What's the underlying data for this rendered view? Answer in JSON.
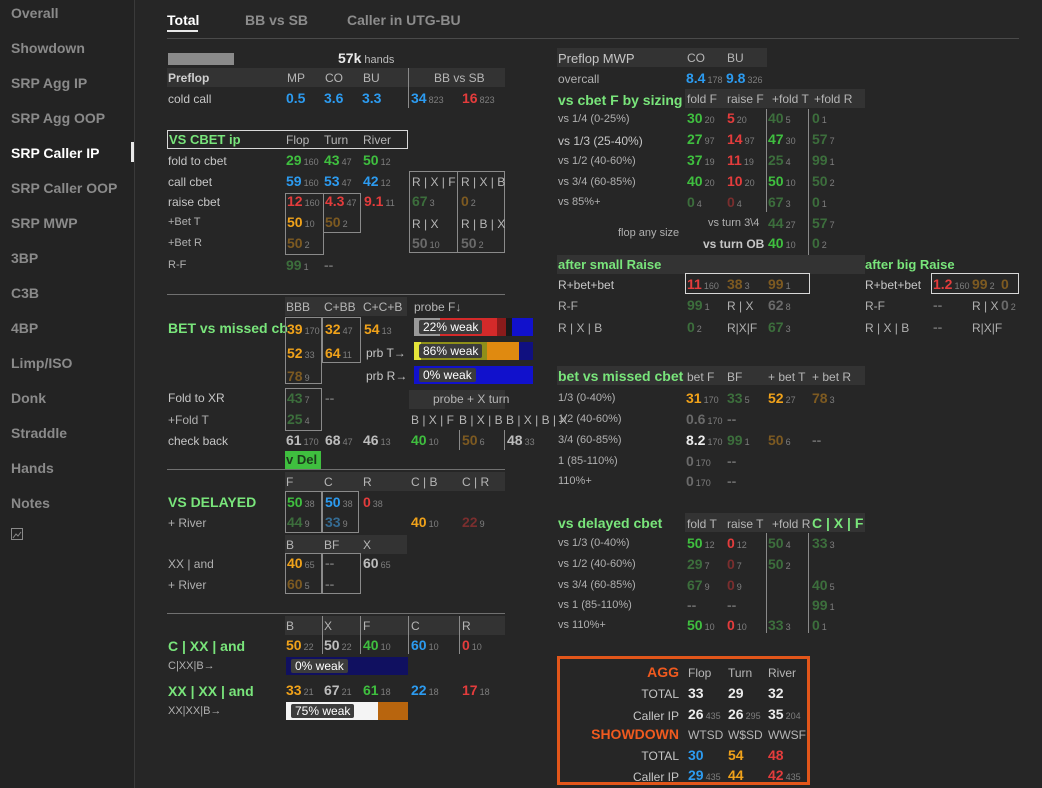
{
  "sidebar": {
    "items": [
      "Overall",
      "Showdown",
      "SRP Agg IP",
      "SRP Agg OOP",
      "SRP Caller IP",
      "SRP Caller OOP",
      "SRP MWP",
      "3BP",
      "C3B",
      "4BP",
      "Limp/ISO",
      "Donk",
      "Straddle",
      "Hands",
      "Notes"
    ],
    "active": "SRP Caller IP",
    "extra_icon": "image-icon"
  },
  "tabs": [
    "Total",
    "BB vs SB",
    "Caller in UTG-BU"
  ],
  "summary": {
    "hands_value": "57k",
    "hands_label": "hands"
  },
  "preflop": {
    "title": "Preflop",
    "headers": [
      "MP",
      "CO",
      "BU",
      "BB vs SB"
    ],
    "row_label": "cold call",
    "values": [
      {
        "v": "0.5",
        "c": "blue"
      },
      {
        "v": "3.6",
        "c": "blue"
      },
      {
        "v": "3.3",
        "c": "blue"
      },
      {
        "v": "34",
        "s": "823",
        "c": "blue"
      },
      {
        "v": "16",
        "s": "823",
        "c": "red"
      }
    ]
  },
  "vs_cbet_ip": {
    "title": "VS CBET ip",
    "headers": [
      "Flop",
      "Turn",
      "River"
    ],
    "rows": [
      {
        "label": "fold to cbet",
        "cells": [
          {
            "v": "29",
            "s": "160",
            "c": "green"
          },
          {
            "v": "43",
            "s": "47",
            "c": "green"
          },
          {
            "v": "50",
            "s": "12",
            "c": "green"
          }
        ]
      },
      {
        "label": "call cbet",
        "cells": [
          {
            "v": "59",
            "s": "160",
            "c": "blue"
          },
          {
            "v": "53",
            "s": "47",
            "c": "blue"
          },
          {
            "v": "42",
            "s": "12",
            "c": "blue"
          }
        ]
      },
      {
        "label": "raise cbet",
        "cells": [
          {
            "v": "12",
            "s": "160",
            "c": "red"
          },
          {
            "v": "4.3",
            "s": "47",
            "c": "red"
          },
          {
            "v": "9.1",
            "s": "11",
            "c": "red"
          }
        ]
      },
      {
        "label": "+Bet T",
        "cells": [
          {
            "v": "50",
            "s": "10",
            "c": "orange"
          },
          {
            "v": "50",
            "s": "2",
            "c": "mo"
          }
        ]
      },
      {
        "label": "+Bet R",
        "cells": [
          {
            "v": "50",
            "s": "2",
            "c": "mo"
          }
        ]
      },
      {
        "label": "R-F",
        "cells": [
          {
            "v": "99",
            "s": "1",
            "c": "mg"
          },
          {
            "v": "--",
            "c": "mgr"
          }
        ]
      }
    ],
    "side": {
      "h1": [
        "R | X | F",
        "R | X | B"
      ],
      "r1": [
        {
          "v": "67",
          "s": "3",
          "c": "mg"
        },
        {
          "v": "0",
          "s": "2",
          "c": "mo"
        }
      ],
      "h2": [
        "R | X",
        "R | B | X"
      ],
      "r2": [
        {
          "v": "50",
          "s": "10",
          "c": "mgr"
        },
        {
          "v": "50",
          "s": "2",
          "c": "mgr"
        }
      ]
    }
  },
  "bet_missed_cb": {
    "title": "BET vs missed cb",
    "headers": [
      "BBB",
      "C+BB",
      "C+C+B"
    ],
    "r1": [
      {
        "v": "39",
        "s": "170",
        "c": "orange"
      },
      {
        "v": "32",
        "s": "47",
        "c": "orange"
      },
      {
        "v": "54",
        "s": "13",
        "c": "orange"
      }
    ],
    "r2": [
      {
        "v": "52",
        "s": "33",
        "c": "orange"
      },
      {
        "v": "64",
        "s": "11",
        "c": "orange"
      }
    ],
    "r3": [
      {
        "v": "78",
        "s": "9",
        "c": "mo"
      }
    ],
    "probe_header": "probe F↓",
    "probe_bars": [
      {
        "label": "",
        "text": "22% weak",
        "segs": [
          {
            "w": 0.22,
            "c": "#9a9a9a"
          },
          {
            "w": 0.48,
            "c": "#d42a2a"
          },
          {
            "w": 0.07,
            "c": "#8a1b1b"
          },
          {
            "w": 0.05,
            "c": "#1a1a1a"
          },
          {
            "w": 0.18,
            "c": "#1111cc"
          }
        ]
      },
      {
        "label": "prb T→",
        "text": "86% weak",
        "segs": [
          {
            "w": 0.06,
            "c": "#e4e43a"
          },
          {
            "w": 0.55,
            "c": "#8f8f1a"
          },
          {
            "w": 0.27,
            "c": "#e08a10"
          },
          {
            "w": 0.12,
            "c": "#101080"
          }
        ]
      },
      {
        "label": "prb R→",
        "text": "0% weak",
        "segs": [
          {
            "w": 1.0,
            "c": "#1111cc"
          }
        ]
      }
    ],
    "fold_to_xr": {
      "label": "Fold to XR",
      "cells": [
        {
          "v": "43",
          "s": "7",
          "c": "mg"
        },
        {
          "v": "--",
          "c": "mgr"
        }
      ]
    },
    "fold_t": {
      "label": "+Fold T",
      "cells": [
        {
          "v": "25",
          "s": "4",
          "c": "mg"
        }
      ]
    },
    "probe_x_turn": {
      "title": "probe + X turn",
      "headers": [
        "B | X | F",
        "B | X | B",
        "B | X | B | X"
      ],
      "cells": [
        {
          "v": "40",
          "s": "10",
          "c": "green"
        },
        {
          "v": "50",
          "s": "6",
          "c": "mo"
        },
        {
          "v": "48",
          "s": "33",
          "c": "gray"
        }
      ]
    },
    "check_back": {
      "label": "check back",
      "cells": [
        {
          "v": "61",
          "s": "170",
          "c": "gray"
        },
        {
          "v": "68",
          "s": "47",
          "c": "gray"
        },
        {
          "v": "46",
          "s": "13",
          "c": "gray"
        }
      ]
    },
    "v_del_chip": "v Del"
  },
  "vs_delayed": {
    "title": "VS DELAYED",
    "headers": [
      "F",
      "C",
      "R",
      "C | B",
      "C | R"
    ],
    "r1": [
      {
        "v": "50",
        "s": "38",
        "c": "green"
      },
      {
        "v": "50",
        "s": "38",
        "c": "blue"
      },
      {
        "v": "0",
        "s": "38",
        "c": "red"
      }
    ],
    "river": {
      "label": "+ River",
      "cells": [
        {
          "v": "44",
          "s": "9",
          "c": "mg"
        },
        {
          "v": "33",
          "s": "9",
          "c": "mb"
        },
        {
          "v": "40",
          "s": "10",
          "c": "orange"
        },
        {
          "v": "22",
          "s": "9",
          "c": "mr"
        }
      ]
    },
    "headers2": [
      "B",
      "BF",
      "X"
    ],
    "xx_and": {
      "label": "XX | and",
      "cells": [
        {
          "v": "40",
          "s": "65",
          "c": "orange"
        },
        {
          "v": "--",
          "c": "mgr"
        },
        {
          "v": "60",
          "s": "65",
          "c": "gray"
        }
      ]
    },
    "river2": {
      "label": "+ River",
      "cells": [
        {
          "v": "60",
          "s": "5",
          "c": "mo"
        },
        {
          "v": "--",
          "c": "mgr"
        }
      ]
    }
  },
  "c_xx_and": {
    "title": "C | XX | and",
    "headers": [
      "B",
      "X",
      "F",
      "C",
      "R"
    ],
    "cells": [
      {
        "v": "50",
        "s": "22",
        "c": "orange"
      },
      {
        "v": "50",
        "s": "22",
        "c": "gray"
      },
      {
        "v": "40",
        "s": "10",
        "c": "green"
      },
      {
        "v": "60",
        "s": "10",
        "c": "blue"
      },
      {
        "v": "0",
        "s": "10",
        "c": "red"
      }
    ],
    "bar_label": "C|XX|B→",
    "bar": {
      "text": "0% weak",
      "segs": [
        {
          "w": 1.0,
          "c": "#101060"
        }
      ]
    }
  },
  "xx_xx_and": {
    "title": "XX | XX | and",
    "cells": [
      {
        "v": "33",
        "s": "21",
        "c": "orange"
      },
      {
        "v": "67",
        "s": "21",
        "c": "gray"
      },
      {
        "v": "61",
        "s": "18",
        "c": "green"
      },
      {
        "v": "22",
        "s": "18",
        "c": "blue"
      },
      {
        "v": "17",
        "s": "18",
        "c": "red"
      }
    ],
    "bar_label": "XX|XX|B→",
    "bar": {
      "text": "75% weak",
      "segs": [
        {
          "w": 0.75,
          "c": "#f4f4f4"
        },
        {
          "w": 0.25,
          "c": "#b8650e"
        }
      ]
    }
  },
  "preflop_mwp": {
    "title": "Preflop MWP",
    "headers": [
      "CO",
      "BU"
    ],
    "row_label": "overcall",
    "cells": [
      {
        "v": "8.4",
        "s": "178",
        "c": "blue"
      },
      {
        "v": "9.8",
        "s": "326",
        "c": "blue"
      }
    ]
  },
  "cbet_sizing": {
    "title": "vs cbet F by sizing",
    "headers": [
      "fold F",
      "raise F",
      "+fold T",
      "+fold R"
    ],
    "rows": [
      {
        "label": "vs 1/4 (0-25%)",
        "cells": [
          {
            "v": "30",
            "s": "20",
            "c": "green"
          },
          {
            "v": "5",
            "s": "20",
            "c": "red"
          },
          {
            "v": "40",
            "s": "5",
            "c": "mg"
          },
          {
            "v": "0",
            "s": "1",
            "c": "mg"
          }
        ]
      },
      {
        "label": "vs 1/3 (25-40%)",
        "cells": [
          {
            "v": "27",
            "s": "97",
            "c": "green"
          },
          {
            "v": "14",
            "s": "97",
            "c": "red"
          },
          {
            "v": "47",
            "s": "30",
            "c": "green"
          },
          {
            "v": "57",
            "s": "7",
            "c": "mg"
          }
        ]
      },
      {
        "label": "vs 1/2 (40-60%)",
        "cells": [
          {
            "v": "37",
            "s": "19",
            "c": "green"
          },
          {
            "v": "11",
            "s": "19",
            "c": "red"
          },
          {
            "v": "25",
            "s": "4",
            "c": "mg"
          },
          {
            "v": "99",
            "s": "1",
            "c": "mg"
          }
        ]
      },
      {
        "label": "vs 3/4 (60-85%)",
        "cells": [
          {
            "v": "40",
            "s": "20",
            "c": "green"
          },
          {
            "v": "10",
            "s": "20",
            "c": "red"
          },
          {
            "v": "50",
            "s": "10",
            "c": "green"
          },
          {
            "v": "50",
            "s": "2",
            "c": "mg"
          }
        ]
      },
      {
        "label": "vs 85%+",
        "cells": [
          {
            "v": "0",
            "s": "4",
            "c": "mg"
          },
          {
            "v": "0",
            "s": "4",
            "c": "mr"
          },
          {
            "v": "67",
            "s": "3",
            "c": "mg"
          },
          {
            "v": "0",
            "s": "1",
            "c": "mg"
          }
        ]
      }
    ],
    "flop_any": "flop any size",
    "turn34": {
      "label": "vs turn 3\\4",
      "cells": [
        {
          "v": "44",
          "s": "27",
          "c": "mg"
        },
        {
          "v": "57",
          "s": "7",
          "c": "mg"
        }
      ]
    },
    "turnob": {
      "label": "vs turn OB",
      "cells": [
        {
          "v": "40",
          "s": "10",
          "c": "green"
        },
        {
          "v": "0",
          "s": "2",
          "c": "mg"
        }
      ]
    }
  },
  "after_small_raise": {
    "title": "after small Raise",
    "r1": {
      "label": "R+bet+bet",
      "cells": [
        {
          "v": "11",
          "s": "160",
          "c": "red"
        },
        {
          "v": "38",
          "s": "3",
          "c": "mo"
        },
        {
          "v": "99",
          "s": "1",
          "c": "mo"
        }
      ]
    },
    "r2": {
      "label": "R-F",
      "cells": [
        {
          "v": "99",
          "s": "1",
          "c": "mg"
        }
      ],
      "label2": "R | X",
      "cells2": [
        {
          "v": "62",
          "s": "8",
          "c": "mgr"
        }
      ]
    },
    "r3": {
      "label": "R | X | B",
      "cells": [
        {
          "v": "0",
          "s": "2",
          "c": "mg"
        }
      ],
      "label2": "R|X|F",
      "cells2": [
        {
          "v": "67",
          "s": "3",
          "c": "mg"
        }
      ]
    }
  },
  "after_big_raise": {
    "title": "after big Raise",
    "r1": {
      "label": "R+bet+bet",
      "cells": [
        {
          "v": "1.2",
          "s": "160",
          "c": "red"
        },
        {
          "v": "99",
          "s": "2",
          "c": "mo"
        },
        {
          "v": "0",
          "c": "mo"
        }
      ]
    },
    "r2": {
      "label": "R-F",
      "cells": [
        {
          "v": "--",
          "c": "mgr"
        }
      ],
      "label2": "R | X",
      "cells2": [
        {
          "v": "0",
          "s": "2",
          "c": "mgr"
        }
      ]
    },
    "r3": {
      "label": "R | X | B",
      "cells": [
        {
          "v": "--",
          "c": "mgr"
        }
      ],
      "label2": "R|X|F",
      "cells2": []
    }
  },
  "bet_missed_cbet": {
    "title": "bet vs missed cbet",
    "headers": [
      "bet F",
      "BF",
      "+ bet T",
      "+ bet R"
    ],
    "rows": [
      {
        "label": "1/3 (0-40%)",
        "cells": [
          {
            "v": "31",
            "s": "170",
            "c": "orange"
          },
          {
            "v": "33",
            "s": "5",
            "c": "mg"
          },
          {
            "v": "52",
            "s": "27",
            "c": "orange"
          },
          {
            "v": "78",
            "s": "3",
            "c": "mo"
          }
        ]
      },
      {
        "label": "1/2 (40-60%)",
        "cells": [
          {
            "v": "0.6",
            "s": "170",
            "c": "mgr"
          },
          {
            "v": "--",
            "c": "mgr"
          }
        ]
      },
      {
        "label": "3/4 (60-85%)",
        "cells": [
          {
            "v": "8.2",
            "s": "170",
            "c": "white"
          },
          {
            "v": "99",
            "s": "1",
            "c": "mg"
          },
          {
            "v": "50",
            "s": "6",
            "c": "mo"
          },
          {
            "v": "--",
            "c": "mgr"
          }
        ]
      },
      {
        "label": "1 (85-110%)",
        "cells": [
          {
            "v": "0",
            "s": "170",
            "c": "mgr"
          },
          {
            "v": "--",
            "c": "mgr"
          }
        ]
      },
      {
        "label": "110%+",
        "cells": [
          {
            "v": "0",
            "s": "170",
            "c": "mgr"
          },
          {
            "v": "--",
            "c": "mgr"
          }
        ]
      }
    ]
  },
  "vs_delayed_cbet": {
    "title": "vs delayed cbet",
    "headers": [
      "fold T",
      "raise T",
      "+fold R"
    ],
    "header_green": "C | X | F",
    "rows": [
      {
        "label": "vs 1/3 (0-40%)",
        "cells": [
          {
            "v": "50",
            "s": "12",
            "c": "green"
          },
          {
            "v": "0",
            "s": "12",
            "c": "red"
          },
          {
            "v": "50",
            "s": "4",
            "c": "mg"
          },
          {
            "v": "33",
            "s": "3",
            "c": "mg"
          }
        ]
      },
      {
        "label": "vs 1/2 (40-60%)",
        "cells": [
          {
            "v": "29",
            "s": "7",
            "c": "mg"
          },
          {
            "v": "0",
            "s": "7",
            "c": "mr"
          },
          {
            "v": "50",
            "s": "2",
            "c": "mg"
          }
        ]
      },
      {
        "label": "vs 3/4 (60-85%)",
        "cells": [
          {
            "v": "67",
            "s": "9",
            "c": "mg"
          },
          {
            "v": "0",
            "s": "9",
            "c": "mr"
          },
          {
            "v": "40",
            "s": "5",
            "c": "mg"
          }
        ]
      },
      {
        "label": "vs 1 (85-110%)",
        "cells": [
          {
            "v": "--",
            "c": "mgr"
          },
          {
            "v": "--",
            "c": "mgr"
          },
          {
            "v": "99",
            "s": "1",
            "c": "mg"
          }
        ]
      },
      {
        "label": "vs 110%+",
        "cells": [
          {
            "v": "50",
            "s": "10",
            "c": "green"
          },
          {
            "v": "0",
            "s": "10",
            "c": "red"
          },
          {
            "v": "33",
            "s": "3",
            "c": "mg"
          },
          {
            "v": "0",
            "s": "1",
            "c": "mg"
          }
        ]
      }
    ]
  },
  "summary_box": {
    "agg": {
      "title": "AGG",
      "headers": [
        "Flop",
        "Turn",
        "River"
      ],
      "total": {
        "label": "TOTAL",
        "cells": [
          {
            "v": "33",
            "c": "white"
          },
          {
            "v": "29",
            "c": "white"
          },
          {
            "v": "32",
            "c": "white"
          }
        ]
      },
      "caller": {
        "label": "Caller IP",
        "cells": [
          {
            "v": "26",
            "s": "435",
            "c": "white"
          },
          {
            "v": "26",
            "s": "295",
            "c": "white"
          },
          {
            "v": "35",
            "s": "204",
            "c": "white"
          }
        ]
      }
    },
    "showdown": {
      "title": "SHOWDOWN",
      "headers": [
        "WTSD",
        "W$SD",
        "WWSF"
      ],
      "total": {
        "label": "TOTAL",
        "cells": [
          {
            "v": "30",
            "c": "blue"
          },
          {
            "v": "54",
            "c": "orange"
          },
          {
            "v": "48",
            "c": "red"
          }
        ]
      },
      "caller": {
        "label": "Caller IP",
        "cells": [
          {
            "v": "29",
            "s": "435",
            "c": "blue"
          },
          {
            "v": "44",
            "c": "orange"
          },
          {
            "v": "42",
            "s": "435",
            "c": "red"
          }
        ]
      }
    }
  }
}
